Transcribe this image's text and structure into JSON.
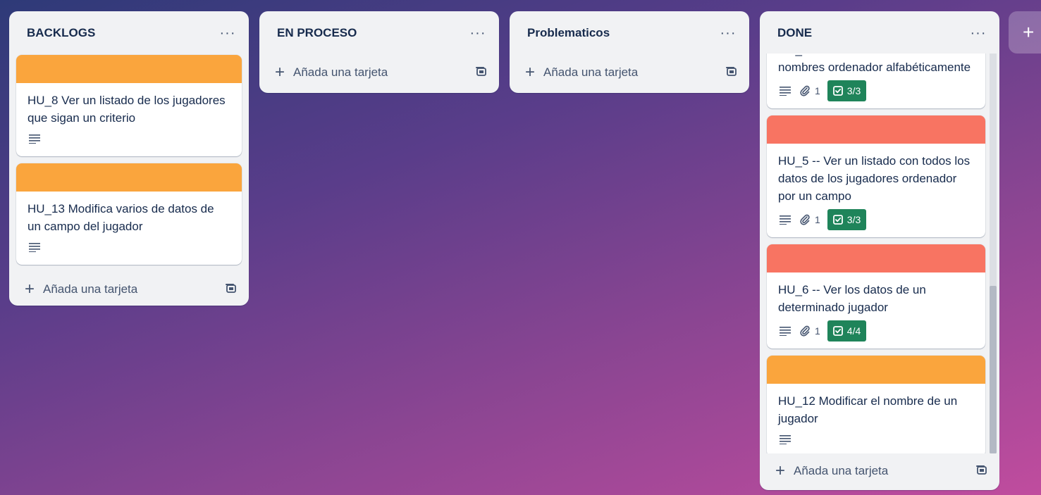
{
  "board": {
    "lists": [
      {
        "title": "BACKLOGS",
        "cards": [
          {
            "title": "HU_8 Ver un listado de los jugadores que sigan un criterio",
            "cover_color": "#faa53d"
          },
          {
            "title": "HU_13 Modifica varios de datos de un campo del jugador",
            "cover_color": "#faa53d"
          }
        ],
        "add_card_label": "Añada una tarjeta"
      },
      {
        "title": "EN PROCESO",
        "add_card_label": "Añada una tarjeta"
      },
      {
        "title": "Problematicos",
        "add_card_label": "Añada una tarjeta"
      },
      {
        "title": "DONE",
        "cards": [
          {
            "title": "nombres ordenador alfabéticamente",
            "attachments": "1",
            "checklist": "3/3"
          },
          {
            "title": "HU_5 -- Ver un listado con todos los datos de los jugadores ordenador por un campo",
            "cover_color": "#f87462",
            "attachments": "1",
            "checklist": "3/3"
          },
          {
            "title": "HU_6 -- Ver los datos de un determinado jugador",
            "cover_color": "#f87462",
            "attachments": "1",
            "checklist": "4/4"
          },
          {
            "title": "HU_12 Modificar el nombre de un jugador",
            "cover_color": "#faa53d"
          }
        ],
        "add_card_label": "Añada una tarjeta"
      }
    ],
    "add_list_symbol": "+"
  },
  "icons": {
    "list_menu": "ellipsis-icon",
    "description": "description-icon",
    "attachment": "paperclip-icon",
    "checklist": "checkbox-icon",
    "template": "card-template-icon"
  }
}
